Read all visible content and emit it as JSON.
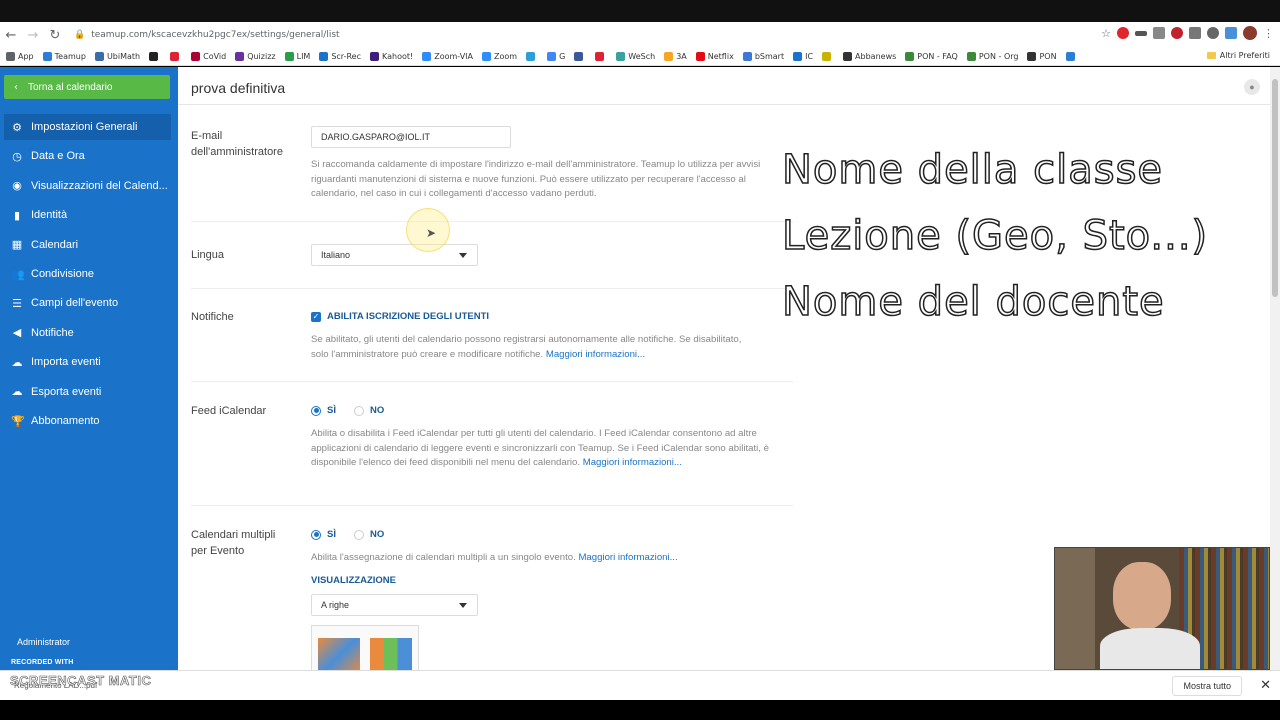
{
  "browser": {
    "url": "teamup.com/kscacevzkhu2pgc7ex/settings/general/list",
    "bookmarks": [
      "App",
      "Teamup",
      "UbiMath",
      "",
      "",
      "CoVid",
      "Quizizz",
      "LIM",
      "Scr-Rec",
      "Kahoot!",
      "Zoom-VIA",
      "Zoom",
      "",
      "G",
      "",
      "",
      "WeSch",
      "3A",
      "Netflix",
      "bSmart",
      "IC",
      "",
      "Abbanews",
      "PON - FAQ",
      "PON - Org",
      "PON",
      ""
    ],
    "other_bookmarks": "Altri Preferiti"
  },
  "sidebar": {
    "back_label": "Torna al calendario",
    "items": [
      {
        "label": "Impostazioni Generali",
        "icon": "gear-icon"
      },
      {
        "label": "Data e Ora",
        "icon": "clock-icon"
      },
      {
        "label": "Visualizzazioni del Calend...",
        "icon": "eye-icon"
      },
      {
        "label": "Identità",
        "icon": "bookmark-icon"
      },
      {
        "label": "Calendari",
        "icon": "calendar-icon"
      },
      {
        "label": "Condivisione",
        "icon": "users-icon"
      },
      {
        "label": "Campi dell'evento",
        "icon": "list-icon"
      },
      {
        "label": "Notifiche",
        "icon": "speaker-icon"
      },
      {
        "label": "Importa eventi",
        "icon": "cloud-upload-icon"
      },
      {
        "label": "Esporta eventi",
        "icon": "cloud-download-icon"
      },
      {
        "label": "Abbonamento",
        "icon": "trophy-icon"
      }
    ],
    "admin_label": "Administrator"
  },
  "main": {
    "title": "prova definitiva",
    "email": {
      "label": "E-mail dell'amministratore",
      "value": "DARIO.GASPARO@IOL.IT",
      "help": "Si raccomanda caldamente di impostare l'indirizzo e-mail dell'amministratore. Teamup lo utilizza per avvisi riguardanti manutenzioni di sistema e nuove funzioni. Può essere utilizzato per recuperare l'accesso al calendario, nel caso in cui i collegamenti d'accesso vadano perduti."
    },
    "language": {
      "label": "Lingua",
      "value": "Italiano"
    },
    "notifications": {
      "label": "Notifiche",
      "checkbox_label": "ABILITA ISCRIZIONE DEGLI UTENTI",
      "help": "Se abilitato, gli utenti del calendario possono registrarsi autonomamente alle notifiche. Se disabilitato, solo l'amministratore può creare e modificare notifiche.",
      "more": "Maggiori informazioni..."
    },
    "ical": {
      "label": "Feed iCalendar",
      "yes": "SÌ",
      "no": "NO",
      "help": "Abilita o disabilita i Feed iCalendar per tutti gli utenti del calendario. I Feed iCalendar consentono ad altre applicazioni di calendario di leggere eventi e sincronizzarli con Teamup. Se i Feed iCalendar sono abilitati, è disponibile l'elenco dei feed disponibili nel menu del calendario.",
      "more": "Maggiori informazioni..."
    },
    "multi": {
      "label": "Calendari multipli per Evento",
      "yes": "SÌ",
      "no": "NO",
      "help": "Abilita l'assegnazione di calendari multipli a un singolo evento.",
      "more": "Maggiori informazioni...",
      "view_heading": "VISUALIZZAZIONE",
      "view_value": "A righe"
    }
  },
  "overlay": {
    "line1": "Nome della classe",
    "line2": "Lezione (Geo, Sto...)",
    "line3": "Nome del docente"
  },
  "footer": {
    "recorded": "RECORDED WITH",
    "screencast": "SCREENCAST  MATIC",
    "download": "Regolamento LAD...pdf",
    "show_all": "Mostra tutto"
  },
  "colors": {
    "sidebar": "#1a73c8",
    "back_button": "#58b947",
    "accent_text": "#1a5a96"
  }
}
